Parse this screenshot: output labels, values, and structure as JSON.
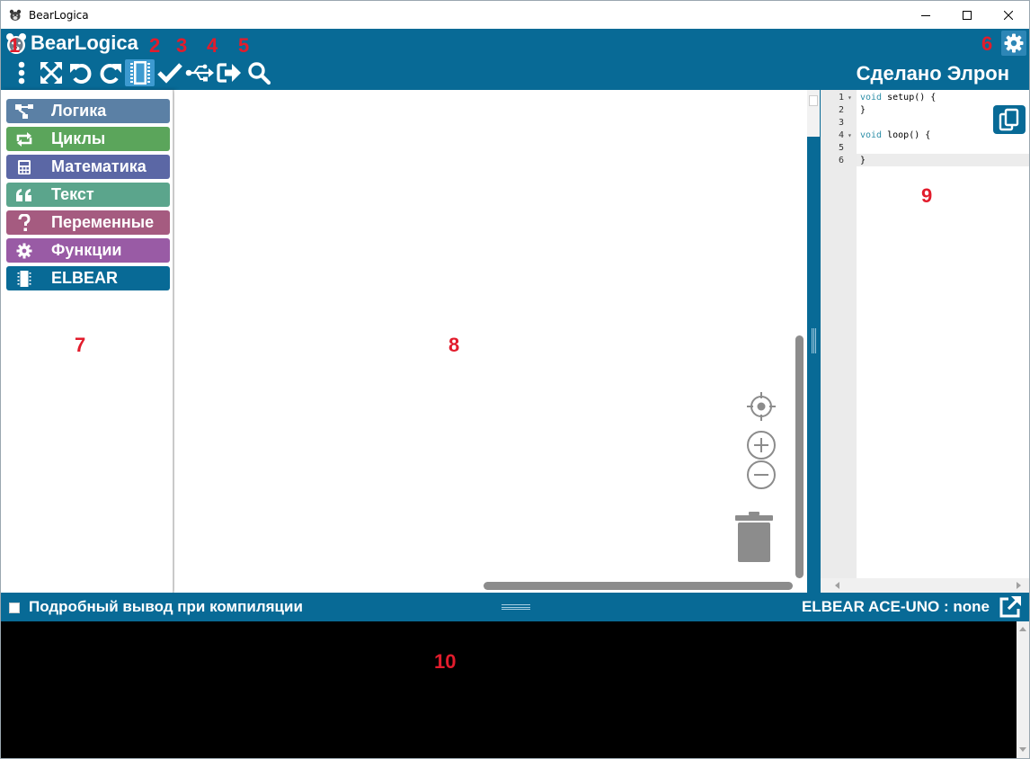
{
  "window": {
    "title": "BearLogica"
  },
  "header": {
    "brand": "BearLogica",
    "made_by": "Сделано Элрон",
    "toolbar": [
      {
        "icon": "menu-dots-icon"
      },
      {
        "icon": "fullscreen-arrows-icon"
      },
      {
        "icon": "undo-icon"
      },
      {
        "icon": "redo-icon"
      },
      {
        "icon": "board-chip-icon",
        "active": true
      },
      {
        "icon": "verify-check-icon"
      },
      {
        "icon": "usb-icon"
      },
      {
        "icon": "upload-arrow-icon"
      },
      {
        "icon": "search-icon"
      }
    ]
  },
  "markers": [
    "1",
    "2",
    "3",
    "4",
    "5",
    "6",
    "7",
    "8",
    "9",
    "10"
  ],
  "categories": [
    {
      "label": "Логика",
      "icon": "logic-tree-icon",
      "color": "#5b80a5"
    },
    {
      "label": "Циклы",
      "icon": "loop-arrows-icon",
      "color": "#5ba55b"
    },
    {
      "label": "Математика",
      "icon": "calculator-icon",
      "color": "#5b67a5"
    },
    {
      "label": "Текст",
      "icon": "quote-icon",
      "color": "#5ba58c"
    },
    {
      "label": "Переменные",
      "icon": "question-icon",
      "color": "#a55b80"
    },
    {
      "label": "Функции",
      "icon": "gear-icon",
      "color": "#995ba5"
    },
    {
      "label": "ELBEAR",
      "icon": "chip-icon",
      "color": "#086a96"
    }
  ],
  "code": {
    "lines": [
      {
        "no": "1",
        "fold": true,
        "kw": "void",
        "rest": " setup() {"
      },
      {
        "no": "2",
        "fold": false,
        "kw": "",
        "rest": "}"
      },
      {
        "no": "3",
        "fold": false,
        "kw": "",
        "rest": ""
      },
      {
        "no": "4",
        "fold": true,
        "kw": "void",
        "rest": " loop() {"
      },
      {
        "no": "5",
        "fold": false,
        "kw": "",
        "rest": ""
      },
      {
        "no": "6",
        "fold": false,
        "kw": "",
        "rest": "}"
      }
    ]
  },
  "bottom": {
    "verbose_label": "Подробный вывод при компиляции",
    "board_status": "ELBEAR ACE-UNO : none"
  }
}
